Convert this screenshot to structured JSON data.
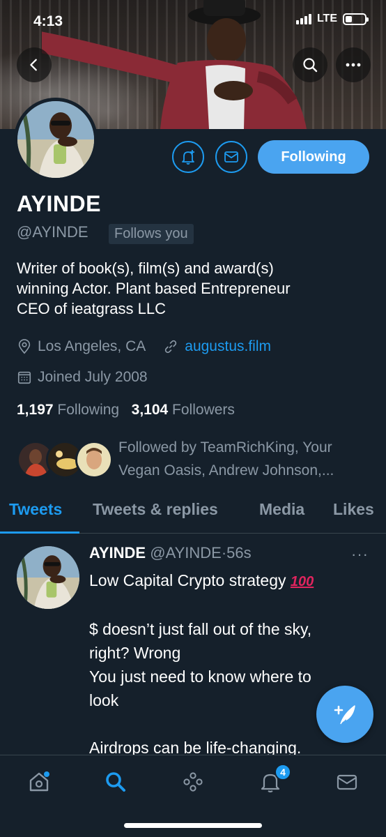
{
  "status_bar": {
    "time": "4:13",
    "network": "LTE"
  },
  "header": {
    "back_icon": "chevron-left-icon",
    "search_icon": "search-icon",
    "more_icon": "more-horizontal-icon"
  },
  "profile": {
    "name": "AYINDE",
    "handle": "@AYINDE",
    "follows_you": "Follows you",
    "following_button": "Following",
    "bio_lines": [
      "Writer of book(s), film(s) and award(s)",
      "winning Actor. Plant based Entrepreneur",
      "CEO of ieatgrass LLC"
    ],
    "location": "Los Angeles, CA",
    "website": "augustus.film",
    "joined": "Joined July 2008",
    "following_count": "1,197",
    "following_label": "Following",
    "followers_count": "3,104",
    "followers_label": "Followers",
    "followed_by_lines": [
      "Followed by TeamRichKing, Your",
      "Vegan Oasis, Andrew Johnson,..."
    ]
  },
  "tabs": [
    {
      "label": "Tweets",
      "active": true
    },
    {
      "label": "Tweets & replies",
      "active": false
    },
    {
      "label": "Media",
      "active": false
    },
    {
      "label": "Likes",
      "active": false
    }
  ],
  "tweet": {
    "name": "AYINDE",
    "handle": "@AYINDE",
    "separator": "·",
    "time": "56s",
    "more": "···",
    "line1": "Low Capital Crypto strategy",
    "emoji": "100",
    "lines": [
      "$ doesn’t just fall out of the sky,",
      "right? Wrong",
      "You just need to know where to",
      "look",
      "",
      "Airdrops can be life-changing."
    ]
  },
  "bottom_nav": {
    "items": [
      "home-icon",
      "search-icon",
      "spaces-icon",
      "notifications-icon",
      "messages-icon"
    ],
    "notification_badge": "4"
  },
  "colors": {
    "background": "#15202b",
    "accent": "#1d9bf0",
    "muted": "#8b98a5"
  }
}
